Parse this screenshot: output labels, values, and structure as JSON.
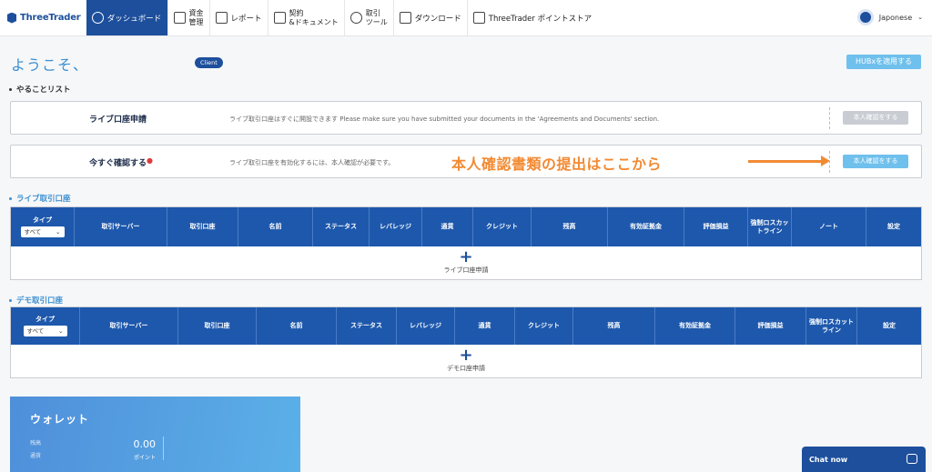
{
  "nav": {
    "brand": "ThreeTrader",
    "items": [
      {
        "label": "ダッシュボード",
        "icon": "dashboard-icon"
      },
      {
        "line1": "資金",
        "line2": "管理",
        "icon": "wallet-icon"
      },
      {
        "label": "レポート",
        "icon": "report-icon"
      },
      {
        "line1": "契約",
        "line2": "&ドキュメント",
        "icon": "document-icon"
      },
      {
        "line1": "取引",
        "line2": "ツール",
        "icon": "globe-icon"
      },
      {
        "label": "ダウンロード",
        "icon": "download-icon"
      },
      {
        "label": "ThreeTrader ポイントストア",
        "icon": "cart-icon"
      }
    ],
    "language": "Japonese"
  },
  "welcome": {
    "text": "ようこそ、",
    "badge": "Client",
    "hubx_button": "HUBxを適用する"
  },
  "todo": {
    "section_title": "やることリスト",
    "items": [
      {
        "title": "ライブ口座申請",
        "desc": "ライブ取引口座はすぐに開設できます Please make sure you have submitted your documents in the 'Agreements and Documents' section.",
        "button": "本人確認をする"
      },
      {
        "title": "今すぐ確認する",
        "desc": "ライブ取引口座を有効化するには、本人確認が必要です。",
        "button": "本人確認をする"
      }
    ]
  },
  "annotation": "本人確認書類の提出はここから",
  "live": {
    "section_title": "ライブ取引口座",
    "type_label": "タイプ",
    "type_value": "すべて",
    "columns": [
      "取引サーバー",
      "取引口座",
      "名前",
      "ステータス",
      "レバレッジ",
      "通貨",
      "クレジット",
      "残高",
      "有効証拠金",
      "評価損益",
      "強制ロスカットライン",
      "ノート",
      "設定"
    ],
    "add_label": "ライブ口座申請"
  },
  "demo": {
    "section_title": "デモ取引口座",
    "type_label": "タイプ",
    "type_value": "すべて",
    "columns": [
      "取引サーバー",
      "取引口座",
      "名前",
      "ステータス",
      "レバレッジ",
      "通貨",
      "クレジット",
      "残高",
      "有効証拠金",
      "評価損益",
      "強制ロスカットライン",
      "設定"
    ],
    "add_label": "デモ口座申請"
  },
  "wallet": {
    "title": "ウォレット",
    "label1": "残高",
    "label2": "通貨",
    "balance": "0.00",
    "points_label": "ポイント"
  },
  "chat": {
    "label": "Chat now"
  }
}
